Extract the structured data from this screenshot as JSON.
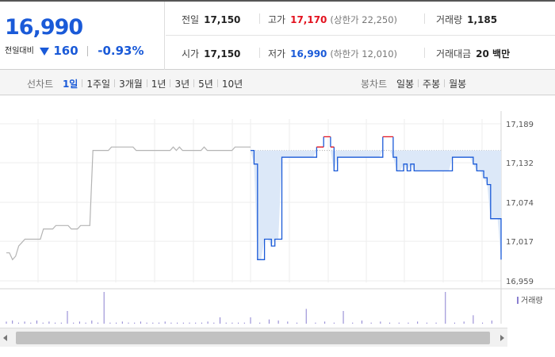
{
  "header": {
    "current_price": "16,990",
    "change_label": "전일대비",
    "change_amount": "160",
    "change_percent": "-0.93%",
    "stats": {
      "prev_close": {
        "label": "전일",
        "value": "17,150"
      },
      "high": {
        "label": "고가",
        "value": "17,170",
        "note": "(상한가 22,250)"
      },
      "volume": {
        "label": "거래량",
        "value": "1,185"
      },
      "open": {
        "label": "시가",
        "value": "17,150"
      },
      "low": {
        "label": "저가",
        "value": "16,990",
        "note": "(하한가 12,010)"
      },
      "trade_amount": {
        "label": "거래대금",
        "value": "20 백만"
      }
    }
  },
  "toolbar": {
    "line_label": "선차트",
    "line_ranges": [
      "1일",
      "1주일",
      "3개월",
      "1년",
      "3년",
      "5년",
      "10년"
    ],
    "line_active": "1일",
    "candle_label": "봉차트",
    "candle_ranges": [
      "일봉",
      "주봉",
      "월봉"
    ]
  },
  "chart_data": {
    "type": "line",
    "y_ticks": [
      17189,
      17132,
      17074,
      17017,
      16959
    ],
    "y_tick_labels": [
      "17,189",
      "17,132",
      "17,074",
      "17,017",
      "16,959"
    ],
    "ylim": [
      16959,
      17189
    ],
    "prev_close": 17150,
    "colors": {
      "up": "#e3121f",
      "down": "#1a5ad8",
      "fill": "#dce8f8",
      "prev_line": "#aaaaaa",
      "volume": "#8a7fd0"
    },
    "prev_day_series": {
      "name": "",
      "values": [
        17000,
        17000,
        16990,
        16995,
        17010,
        17015,
        17020,
        17020,
        17020,
        17020,
        17020,
        17020,
        17035,
        17035,
        17035,
        17035,
        17040,
        17040,
        17040,
        17040,
        17040,
        17035,
        17035,
        17035,
        17040,
        17040,
        17040,
        17040,
        17150,
        17150,
        17150,
        17150,
        17150,
        17150,
        17155,
        17155,
        17155,
        17155,
        17155,
        17155,
        17155,
        17155,
        17150,
        17150,
        17150,
        17150,
        17150,
        17150,
        17150,
        17150,
        17150,
        17150,
        17150,
        17150,
        17155,
        17150,
        17155,
        17150,
        17150,
        17150,
        17150,
        17150,
        17150,
        17150,
        17155,
        17150,
        17150,
        17150,
        17150,
        17150,
        17150,
        17150,
        17150,
        17150,
        17155,
        17155,
        17155,
        17155,
        17155,
        17155
      ]
    },
    "today_series": {
      "name": "",
      "values": [
        17150,
        17130,
        16990,
        16990,
        17020,
        17020,
        17010,
        17020,
        17020,
        17140,
        17140,
        17140,
        17140,
        17140,
        17140,
        17140,
        17140,
        17140,
        17140,
        17155,
        17155,
        17170,
        17170,
        17155,
        17120,
        17140,
        17140,
        17140,
        17140,
        17140,
        17140,
        17140,
        17140,
        17140,
        17140,
        17140,
        17140,
        17140,
        17170,
        17170,
        17170,
        17140,
        17120,
        17120,
        17130,
        17120,
        17130,
        17120,
        17120,
        17120,
        17120,
        17120,
        17120,
        17120,
        17120,
        17120,
        17120,
        17120,
        17140,
        17140,
        17140,
        17140,
        17140,
        17140,
        17130,
        17120,
        17120,
        17110,
        17100,
        17050,
        17050,
        17050,
        16990
      ]
    },
    "volumes_prev": [
      2,
      3,
      1,
      2,
      1,
      3,
      1,
      2,
      1,
      1,
      12,
      1,
      2,
      1,
      3,
      1,
      30,
      1,
      1,
      2,
      1,
      1,
      2,
      1,
      1,
      1,
      2,
      1,
      1,
      1,
      1,
      1,
      1,
      2,
      1,
      6,
      1,
      1,
      1,
      1
    ],
    "volumes_today": [
      6,
      1,
      4,
      3,
      2,
      1,
      14,
      1,
      2,
      1,
      12,
      1,
      3,
      1,
      2,
      1,
      1,
      1,
      2,
      1,
      1,
      30,
      1,
      2,
      8,
      1,
      3
    ],
    "volume_legend": "거래량"
  }
}
